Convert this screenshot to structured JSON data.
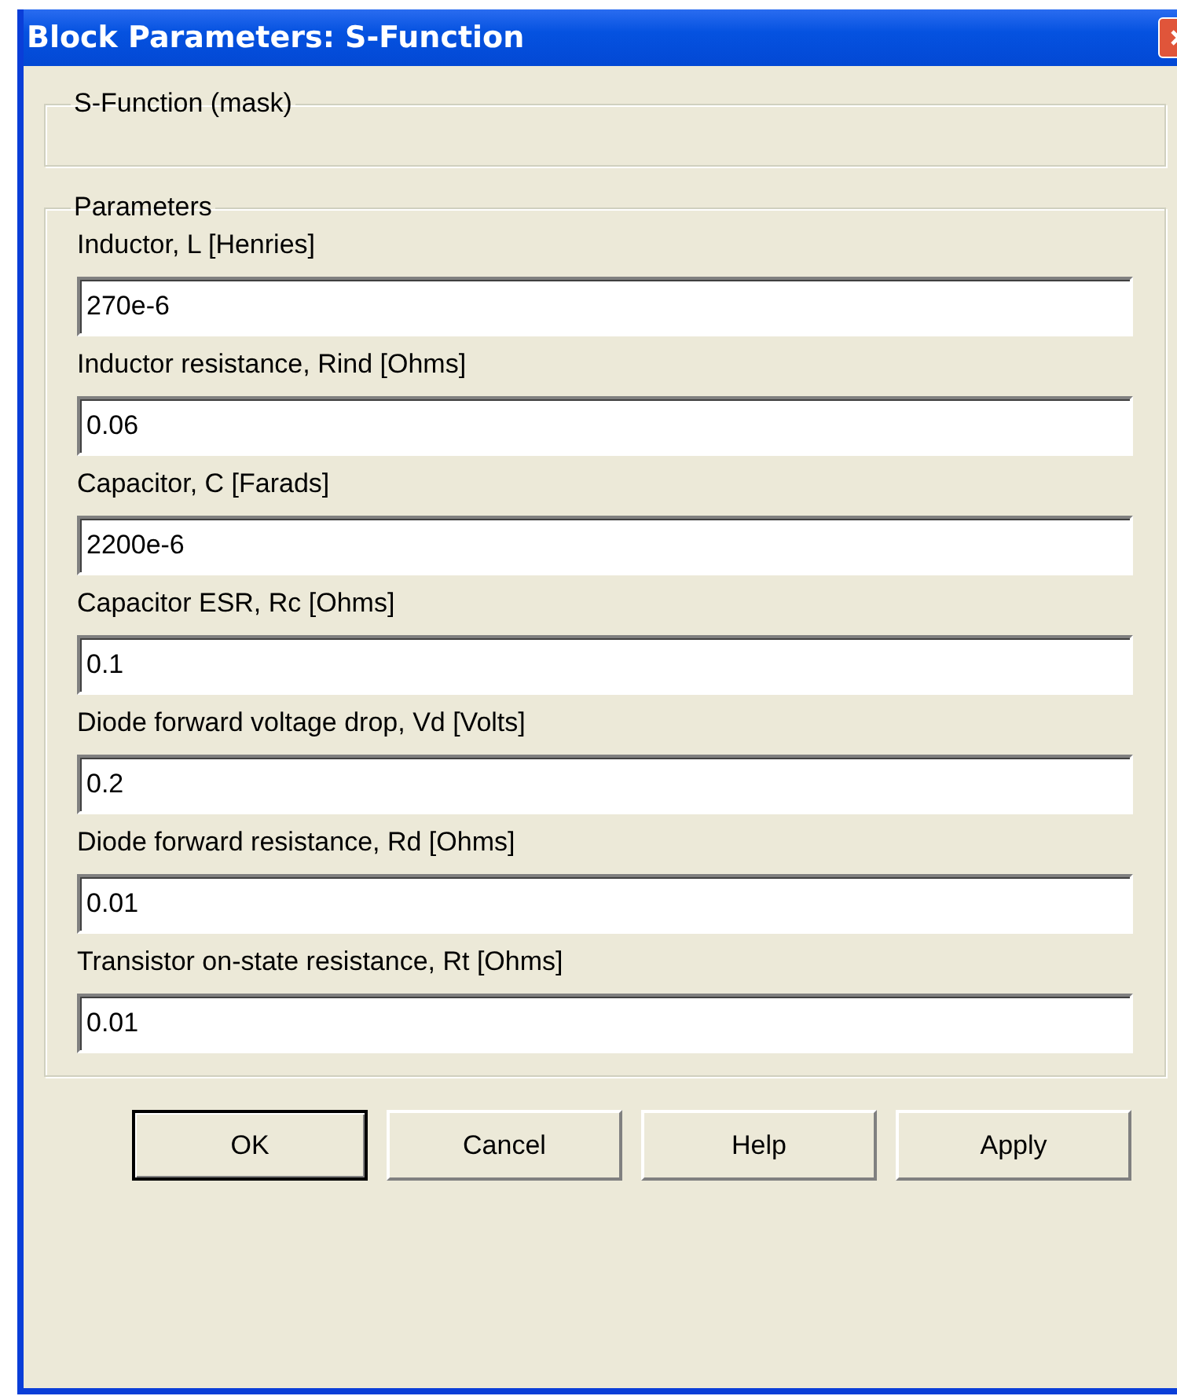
{
  "window": {
    "title": "Block Parameters: S-Function"
  },
  "mask_group": {
    "title": "S-Function (mask)"
  },
  "parameters_group": {
    "title": "Parameters",
    "fields": [
      {
        "label": "Inductor, L [Henries]",
        "value": "270e-6"
      },
      {
        "label": "Inductor resistance, Rind [Ohms]",
        "value": "0.06"
      },
      {
        "label": "Capacitor, C [Farads]",
        "value": "2200e-6"
      },
      {
        "label": "Capacitor ESR, Rc [Ohms]",
        "value": "0.1"
      },
      {
        "label": "Diode forward voltage drop, Vd [Volts]",
        "value": "0.2"
      },
      {
        "label": "Diode forward resistance, Rd [Ohms]",
        "value": "0.01"
      },
      {
        "label": "Transistor on-state resistance, Rt [Ohms]",
        "value": "0.01"
      }
    ]
  },
  "buttons": [
    {
      "label": "OK",
      "default": true
    },
    {
      "label": "Cancel",
      "default": false
    },
    {
      "label": "Help",
      "default": false
    },
    {
      "label": "Apply",
      "default": false
    }
  ]
}
